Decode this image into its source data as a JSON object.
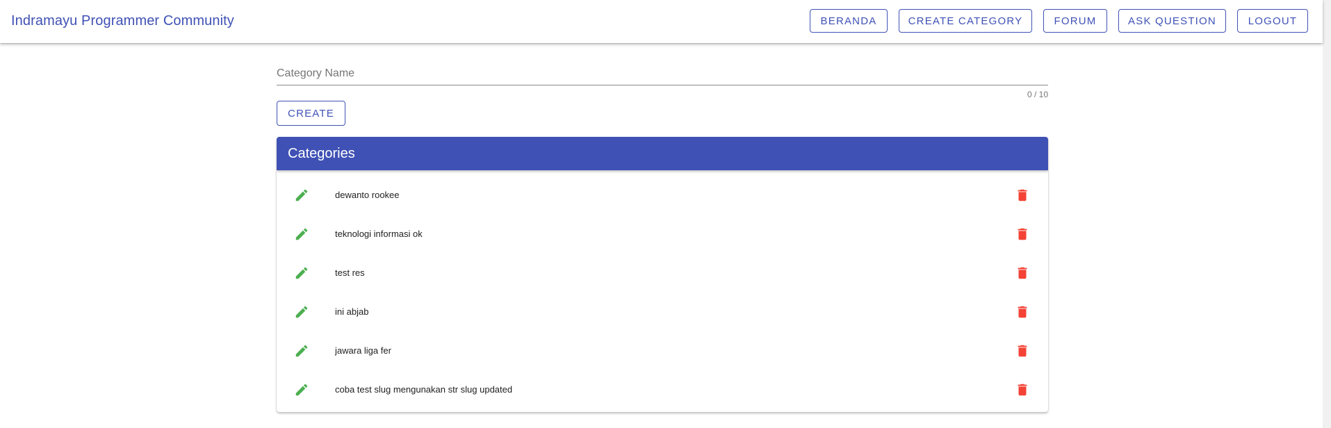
{
  "app": {
    "brand": "Indramayu Programmer Community"
  },
  "nav": {
    "items": [
      {
        "label": "BERANDA"
      },
      {
        "label": "CREATE CATEGORY"
      },
      {
        "label": "FORUM"
      },
      {
        "label": "ASK QUESTION"
      },
      {
        "label": "LOGOUT"
      }
    ]
  },
  "form": {
    "label": "Category Name",
    "value": "",
    "counter": "0 / 10",
    "create_label": "CREATE"
  },
  "categories": {
    "title": "Categories",
    "items": [
      {
        "name": "dewanto rookee"
      },
      {
        "name": "teknologi informasi ok"
      },
      {
        "name": "test res"
      },
      {
        "name": "ini abjab"
      },
      {
        "name": "jawara liga fer"
      },
      {
        "name": "coba test slug mengunakan str slug updated"
      }
    ]
  },
  "colors": {
    "primary": "#3f51b5",
    "edit": "#4caf50",
    "delete": "#f44336"
  },
  "icons": {
    "edit": "pencil-icon",
    "delete": "trash-icon"
  }
}
